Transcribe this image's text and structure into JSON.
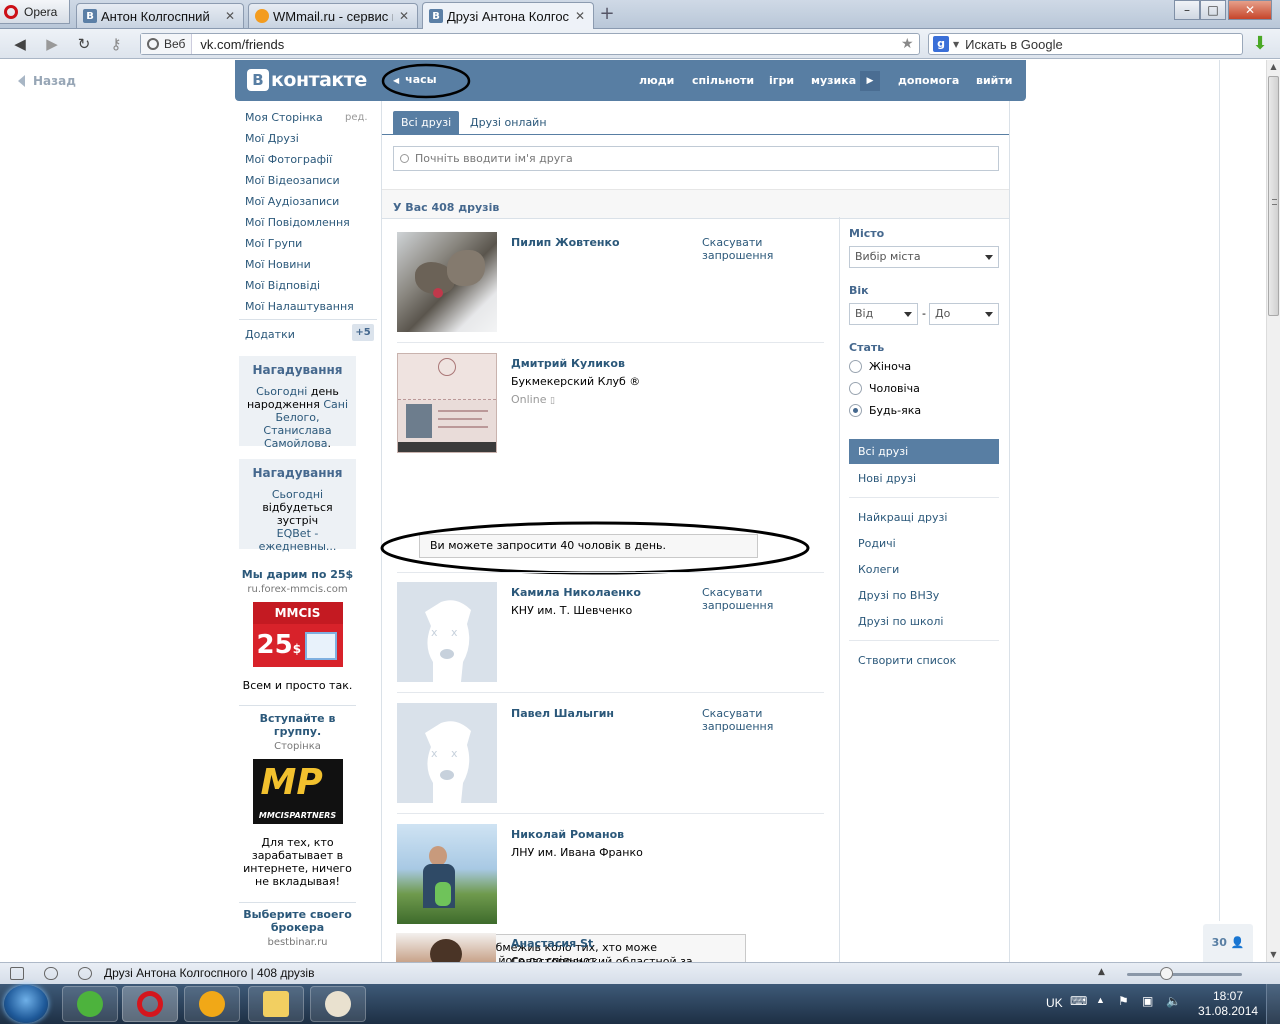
{
  "browser": {
    "menu_label": "Opera",
    "tabs": [
      {
        "label": "Антон Колгоспний"
      },
      {
        "label": "WMmail.ru - сервис п..."
      },
      {
        "label": "Друзі Антона Колгосп..."
      }
    ],
    "address": {
      "mode_label": "Веб",
      "url": "vk.com/friends"
    },
    "search": {
      "placeholder": "Искать в Google"
    },
    "status_text": "Друзі Антона Колгоспного | 408 друзів"
  },
  "page": {
    "back_label": "Назад",
    "header": {
      "logo_text": "контакте",
      "back_label": "часы",
      "menu": [
        "люди",
        "спільноти",
        "ігри",
        "музика",
        "допомога",
        "вийти"
      ]
    },
    "left_nav": {
      "items": [
        "Моя Сторінка",
        "Мої Друзі",
        "Мої Фотографії",
        "Мої Відеозаписи",
        "Мої Аудіозаписи",
        "Мої Повідомлення",
        "Мої Групи",
        "Мої Новини",
        "Мої Відповіді",
        "Мої Налаштування"
      ],
      "edit_label": "ред.",
      "addons_label": "Додатки",
      "addons_badge": "+5"
    },
    "reminders": [
      {
        "title": "Нагадування",
        "line1_link": "Сьогодні",
        "line1_text": " день",
        "line2_text": "народження ",
        "line2_link": "Сані",
        "line3_link": "Белого, Станислава",
        "line4_link": "Самойлова",
        "line4_text": "."
      },
      {
        "title": "Нагадування",
        "line1_link": "Сьогодні",
        "line2_text": "відбудеться зустріч",
        "line3_link": "EQBet -",
        "line4_link": "ежедневны..."
      }
    ],
    "ads": [
      {
        "title": "Мы дарим по 25$",
        "site": "ru.forex-mmcis.com",
        "banner_text": "MMCIS",
        "banner_amount": "25",
        "banner_currency": "$",
        "desc": "Всем и просто так."
      },
      {
        "title": "Вступайте в группу.",
        "site": "Сторінка",
        "banner_text": "MP",
        "banner_sub": "MMCISPARTNERS",
        "desc": "Для тех, кто зарабатывает в интернете, ничего не вкладывая!"
      },
      {
        "title": "Выберите своего брокера",
        "site": "bestbinar.ru"
      }
    ],
    "friends": {
      "tab_all": "Всі друзі",
      "tab_online": "Друзі онлайн",
      "search_placeholder": "Почніть вводити ім'я друга",
      "count_text": "У Вас 408 друзів",
      "list": [
        {
          "name": "Пилип Жовтенко",
          "sub": "",
          "action": "Скасувати запрошення"
        },
        {
          "name": "Дмитрий Куликов",
          "sub": "Букмекерский Клуб ®",
          "online": "Online",
          "action": ""
        },
        {
          "name": "Камила Николаенко",
          "sub": "КНУ им. Т. Шевченко",
          "action": "Скасувати запрошення"
        },
        {
          "name": "Павел Шалыгин",
          "sub": "",
          "action": "Скасувати запрошення"
        },
        {
          "name": "Николай Романов",
          "sub": "ЛНУ им. Ивана Франко",
          "action": ""
        },
        {
          "name": "Анастасия St",
          "sub": "Севастопольский областной за...",
          "action": ""
        }
      ],
      "limit_notice": "Ви можете запросити 40 чоловік в день.",
      "restrict_notice": "Користувач обмежив коло тих, хто може запрошувати його до спільнот."
    },
    "filters": {
      "city_label": "Місто",
      "city_value": "Вибір міста",
      "age_label": "Вік",
      "age_from": "Від",
      "age_dash": "-",
      "age_to": "До",
      "gender_label": "Стать",
      "genders": [
        "Жіноча",
        "Чоловіча",
        "Будь-яка"
      ],
      "gender_selected": 2,
      "lists": [
        "Всі друзі",
        "Нові друзі",
        "Найкращі друзі",
        "Родичі",
        "Колеги",
        "Друзі по ВНЗу",
        "Друзі по школі",
        "Створити список"
      ]
    },
    "corner_counter": "30"
  },
  "taskbar": {
    "language": "UK",
    "time": "18:07",
    "date": "31.08.2014"
  },
  "colors": {
    "vk_blue": "#587ea3",
    "link": "#2b587a"
  }
}
